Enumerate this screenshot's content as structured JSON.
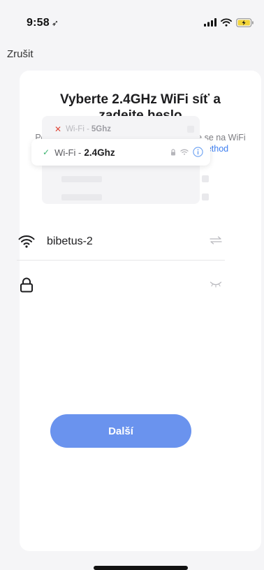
{
  "status_bar": {
    "time": "9:58",
    "location_glyph": "➶",
    "icons": [
      "signal-icon",
      "wifi-icon",
      "battery-charging-icon"
    ]
  },
  "nav": {
    "cancel_label": "Zrušit"
  },
  "card": {
    "title": "Vyberte 2.4GHz WiFi síť a zadejte heslo",
    "subtitle_text": "Pokud je vaše WiFi síť typu 5 GHz, připojte se na WiFi typu 2.4 GHz. ",
    "subtitle_link": "Common router setting method"
  },
  "illustration": {
    "row_5g": {
      "prefix": "Wi-Fi - ",
      "band": "5Ghz",
      "mark": "✕"
    },
    "row_24g": {
      "prefix": "Wi-Fi - ",
      "band": "2.4Ghz",
      "mark": "✓"
    }
  },
  "form": {
    "wifi_name": "bibetus-2",
    "password_value": "",
    "password_placeholder": ""
  },
  "actions": {
    "next_label": "Další"
  },
  "colors": {
    "accent": "#6a93ee",
    "link": "#3d7ef0",
    "error": "#e0493a",
    "success": "#3bb36f"
  }
}
